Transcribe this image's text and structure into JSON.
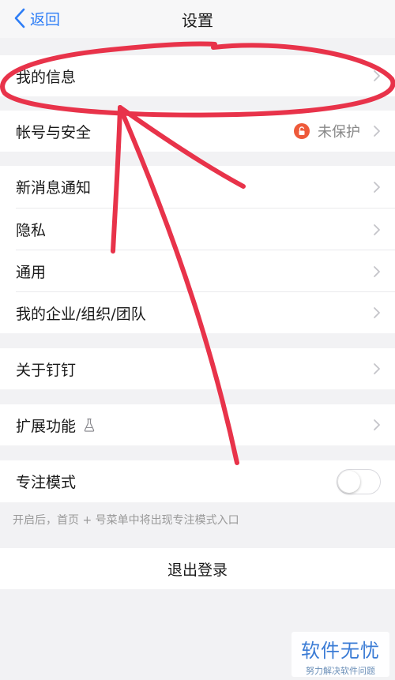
{
  "nav": {
    "back_label": "返回",
    "title": "设置"
  },
  "rows": {
    "my_info": "我的信息",
    "account_security": "帐号与安全",
    "account_status": "未保护",
    "notifications": "新消息通知",
    "privacy": "隐私",
    "general": "通用",
    "my_org": "我的企业/组织/团队",
    "about": "关于钉钉",
    "extensions": "扩展功能",
    "focus_mode": "专注模式"
  },
  "focus_mode_enabled": false,
  "focus_hint": "开启后，首页 + 号菜单中将出现专注模式入口",
  "logout_label": "退出登录",
  "watermark": {
    "main": "软件无忧",
    "sub": "努力解决软件问题"
  },
  "colors": {
    "accent": "#2d7df6",
    "annotation": "#e8334a",
    "lock": "#ee5a3a"
  },
  "icons": [
    "back-chevron-icon",
    "chevron-right-icon",
    "lock-icon",
    "beaker-icon"
  ]
}
